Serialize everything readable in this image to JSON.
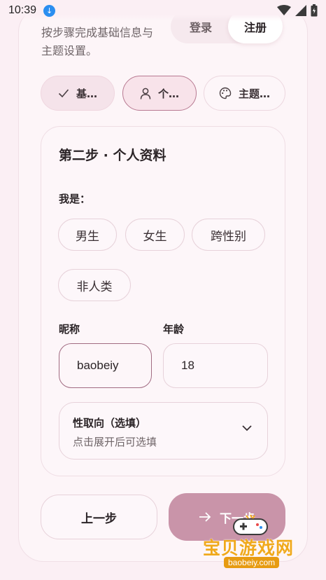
{
  "status_bar": {
    "time": "10:39"
  },
  "intro": {
    "text": "按步骤完成基础信息与主题设置。"
  },
  "auth": {
    "login_label": "登录",
    "register_label": "注册"
  },
  "steps": [
    {
      "label": "基…",
      "icon": "check-icon"
    },
    {
      "label": "个…",
      "icon": "person-icon"
    },
    {
      "label": "主题…",
      "icon": "palette-icon"
    }
  ],
  "card": {
    "title": "第二步 · 个人资料",
    "gender_label": "我是：",
    "gender_options": [
      "男生",
      "女生",
      "跨性别",
      "非人类"
    ],
    "nickname_label": "昵称",
    "nickname_value": "baobeiy",
    "age_label": "年龄",
    "age_value": "18",
    "orientation_title": "性取向（选填）",
    "orientation_hint": "点击展开后可选填"
  },
  "actions": {
    "prev_label": "上一步",
    "next_label": "下一步"
  },
  "watermark": {
    "text": "宝贝游戏网",
    "url": "baobeiy.com"
  },
  "colors": {
    "accent": "#c994a9",
    "accent_border": "#b87a92",
    "background": "#fbeff4"
  }
}
